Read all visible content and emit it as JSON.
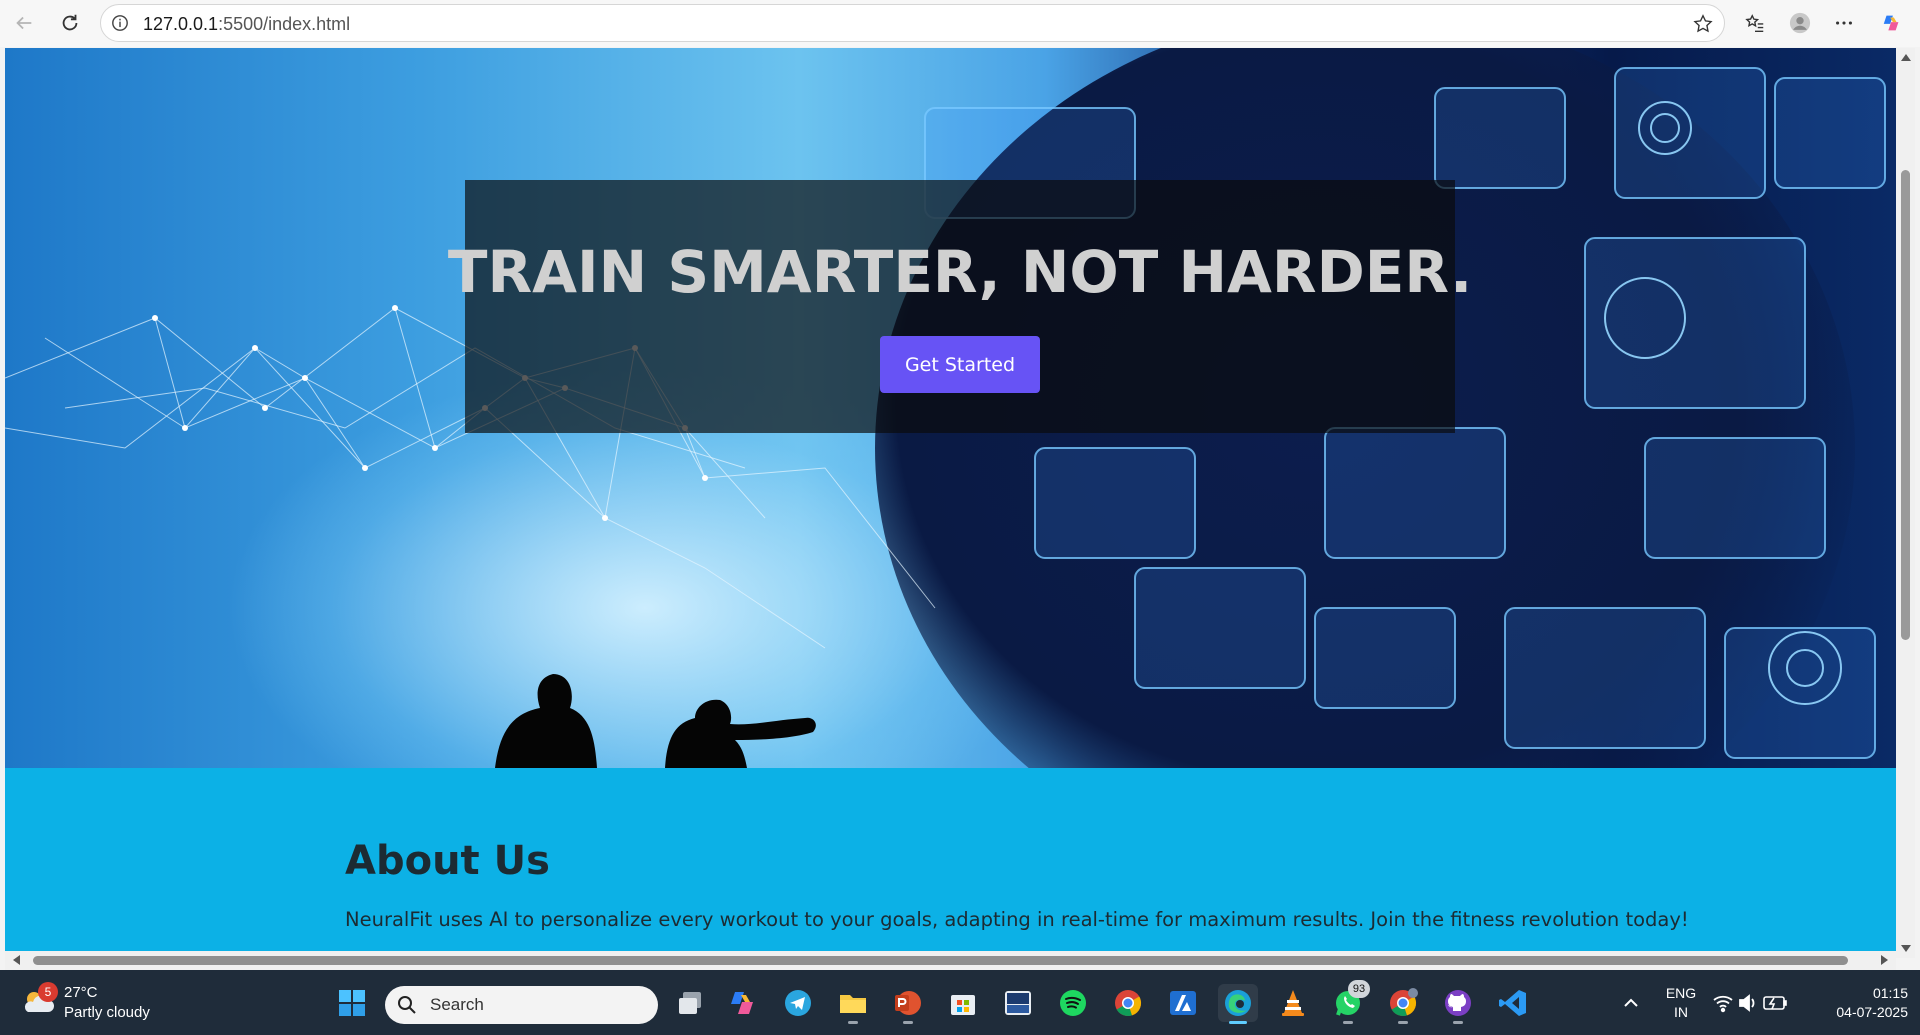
{
  "browser": {
    "url_host": "127.0.0.1",
    "url_path": ":5500/index.html"
  },
  "hero": {
    "title": "TRAIN SMARTER, NOT HARDER.",
    "cta_label": "Get Started"
  },
  "about": {
    "title": "About Us",
    "text": "NeuralFit uses AI to personalize every workout to your goals, adapting in real-time for maximum results. Join the fitness revolution today!"
  },
  "taskbar": {
    "weather": {
      "badge": "5",
      "temp": "27°C",
      "condition": "Partly cloudy"
    },
    "search_placeholder": "Search",
    "whatsapp_badge": "93",
    "lang_line1": "ENG",
    "lang_line2": "IN",
    "time": "01:15",
    "date": "04-07-2025"
  },
  "colors": {
    "cta": "#6753f5",
    "about_bg": "#0cb1e6",
    "taskbar_bg": "#1f2c3a"
  }
}
